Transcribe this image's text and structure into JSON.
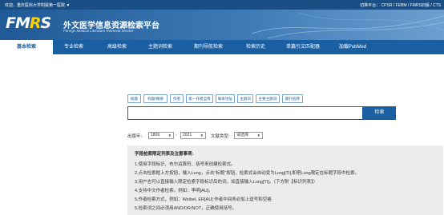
{
  "topbar": {
    "welcome": "欢迎，重庆医科大学附属第一医院 ▼",
    "switch": "切换平台： CPSR / FEBM / FMRS旧版 / CTS"
  },
  "brand": {
    "logo_main": "FMRS",
    "logo_cn": "外文医学信息资源检索平台",
    "logo_en": "Foreign Medical Literature Retrieval Service"
  },
  "nav": {
    "items": [
      {
        "label": "基本检索"
      },
      {
        "label": "专业检索"
      },
      {
        "label": "高级检索"
      },
      {
        "label": "主题词检索"
      },
      {
        "label": "期刊导航检索"
      },
      {
        "label": "检索历史"
      },
      {
        "label": "单篇引文匹配器"
      },
      {
        "label": "加载PubMed"
      }
    ],
    "active_index": 0
  },
  "field_tags": [
    "标题",
    "标题/摘要",
    "作者",
    "第一作者全称",
    "联系地址",
    "主题词",
    "主要主题词",
    "期刊名称"
  ],
  "search": {
    "value": "",
    "button_label": "检索"
  },
  "filters": {
    "year_label": "出版年:",
    "year_from": "1806",
    "year_to": "2021",
    "doctype_label": "文献类型:",
    "doctype_value": "请选择"
  },
  "notes": {
    "title": "字段检索限定列表及注意事项:",
    "lines": [
      "1.使用字段标识、布尔运算符、括号来创建检索式。",
      "2.点击检索框上方按钮，输入Lung，点击\"标题\"按钮，检索式会自动变为Lung[TI],即把Lung限定在标题字段中检索。",
      "3.用户也可以直接输入限定检索字段标识后的词，如直接输入Lung[TI]。（下方附【标识列表】）",
      "4.支持中文作者检索。例如：李明[AU]。",
      "5.作者检索方式，例如：Weibel, ER[AU] 作者中间务必加上逗号和空格",
      "5.检索词之间必须用AND/OR/NOT，正确使用括号。"
    ]
  },
  "colors": {
    "topbar": "#1a4f86",
    "nav": "#1b5fa3",
    "logo_accent": "#ffd000",
    "notes_bg": "#ececec"
  }
}
